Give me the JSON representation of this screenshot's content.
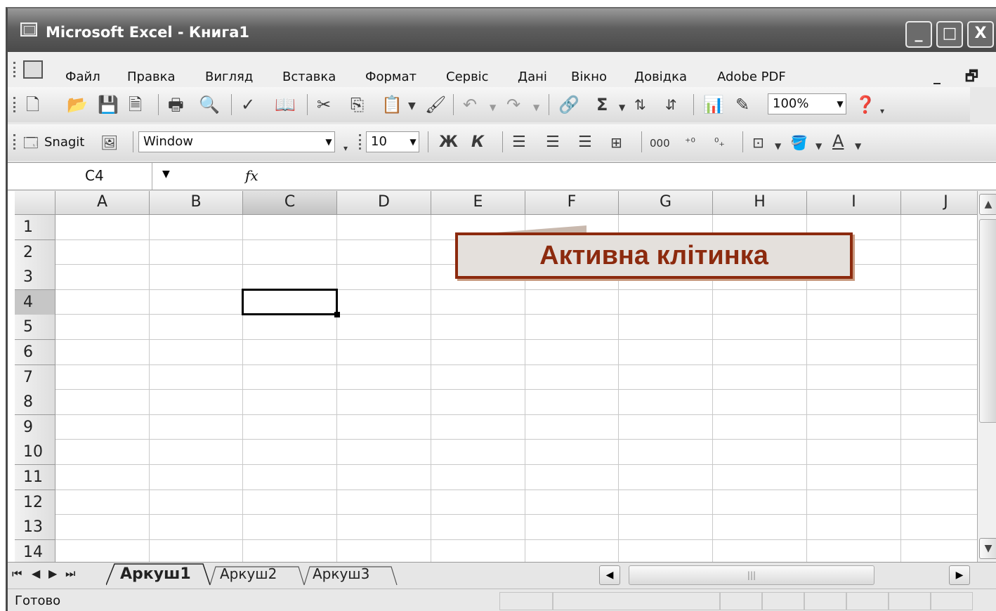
{
  "window": {
    "title": "Microsoft Excel - Книга1",
    "buttons": {
      "minimize": "_",
      "maximize": "□",
      "close": "X"
    }
  },
  "menu": {
    "items": [
      "Файл",
      "Правка",
      "Вигляд",
      "Вставка",
      "Формат",
      "Сервіс",
      "Дані",
      "Вікно",
      "Довідка",
      "Adobe PDF"
    ],
    "doc_controls": "_ 🗗 x"
  },
  "toolbar_standard": {
    "zoom": "100%"
  },
  "toolbar_format": {
    "snagit_label": "Snagit",
    "font_name": "Window",
    "font_size": "10",
    "bold": "Ж",
    "italic": "К",
    "thousands": "000",
    "font_color_letter": "A"
  },
  "formula_bar": {
    "name_box": "C4",
    "fx": "fx",
    "value": ""
  },
  "sheet": {
    "columns": [
      "A",
      "B",
      "C",
      "D",
      "E",
      "F",
      "G",
      "H",
      "I",
      "J"
    ],
    "rows": [
      "1",
      "2",
      "3",
      "4",
      "5",
      "6",
      "7",
      "8",
      "9",
      "10",
      "11",
      "12",
      "13",
      "14"
    ],
    "active_cell": "C4"
  },
  "callout": {
    "text": "Активна клітинка",
    "color": "#8c2a0e"
  },
  "tabs": {
    "sheets": [
      "Аркуш1",
      "Аркуш2",
      "Аркуш3"
    ],
    "active": "Аркуш1"
  },
  "status": {
    "text": "Готово"
  }
}
